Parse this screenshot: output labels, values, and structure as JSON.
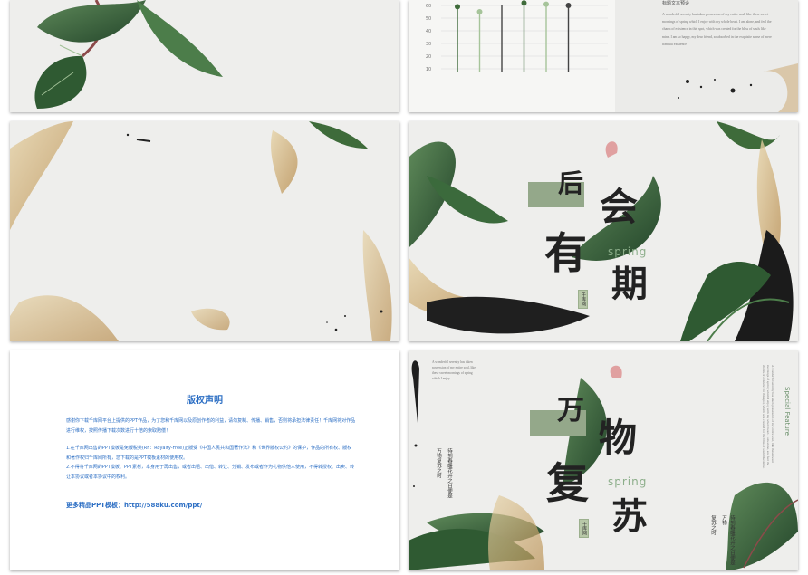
{
  "slide_chart": {
    "title": "标题文本预设",
    "body": "A wonderful serenity has taken possession of my entire soul, like these sweet mornings of spring which I enjoy with my whole heart. I am alone, and feel the charm of existence in this spot, which was created for the bliss of souls like mine. I am so happy, my dear friend, so absorbed in the exquisite sense of mere tranquil existence",
    "chart_data": {
      "type": "bar",
      "subtype": "lollipop",
      "yticks": [
        "60",
        "50",
        "40",
        "30",
        "20",
        "10"
      ],
      "values": [
        59,
        55,
        null,
        62,
        61,
        60
      ],
      "ylim": [
        10,
        60
      ],
      "colors": [
        "#3e6b3a",
        "#a6c49a",
        "#444444",
        "#3e6b3a",
        "#a6c49a",
        "#444444"
      ]
    }
  },
  "slide_spring1": {
    "chars": [
      "后",
      "会",
      "有",
      "期"
    ],
    "spring": "spring",
    "tag": "千库网"
  },
  "slide_copyright": {
    "title": "版权声明",
    "p1": "感谢你下载千库网平台上提供的PPT作品，为了您和千库网以及原创作者的利益，请勿复制、传播、销售，否则将承担法律责任！千库网将对作品进行维权，按照传播下载次数进行十倍的索取赔偿！",
    "p2": "1.在千库网出售的PPT模板是免版税类(RF：Royalty-Free)正版受《中国人民共和国著作法》和《世界版权公约》的保护，作品的所有权、版权和著作权归千库网所有，您下载的是PPT模板素材的使用权。",
    "p3": "2.不得将千库网的PPT模板、PPT素材，本身用于再出售，或者出租、出借、转让、分销、发布或者作为礼物供他人使用，不得转授权、出卖、转让本协议或者本协议中的权利。",
    "more": "更多精品PPT模板：http://588ku.com/ppt/"
  },
  "slide_spring2": {
    "chars": [
      "万",
      "物",
      "复",
      "苏"
    ],
    "spring": "spring",
    "tag": "千库网",
    "vert_left1": "待到春暖花开之日便是",
    "vert_left2": "万物复苏之时",
    "vert_right1": "待到春暖花开之日便是万物",
    "vert_right2": "复苏之时",
    "small_en": "A wonderful serenity has taken possession of my entire soul, like these sweet mornings of spring which I enjoy",
    "special": "Special Feature",
    "vert_en": "A wonderful serenity has taken possession of my entire soul, like these sweet mornings of spring which I enjoy with my whole heart. I am alone, and feel the charm of existence in this spot, which was created for the bliss of souls like mine."
  }
}
